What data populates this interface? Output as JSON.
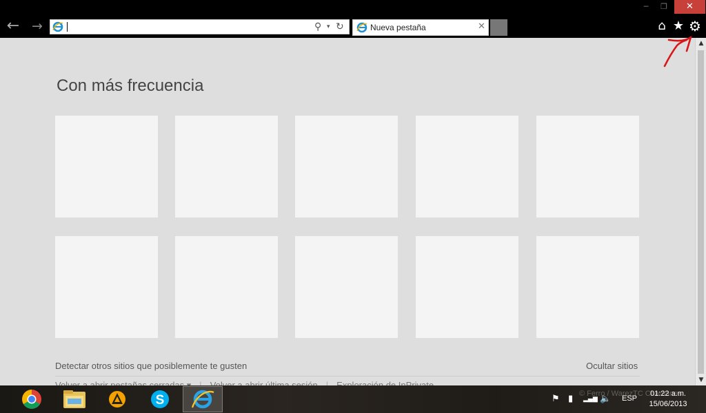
{
  "window": {
    "min_symbol": "─",
    "max_symbol": "❐",
    "close_symbol": "✕"
  },
  "nav": {
    "back_symbol": "←",
    "forward_symbol": "→",
    "address_value": "",
    "search_symbol": "⚲",
    "dropdown_symbol": "▾",
    "refresh_symbol": "↻"
  },
  "tab": {
    "label": "Nueva pestaña",
    "close_symbol": "✕"
  },
  "toolbar": {
    "home_icon": "home-icon",
    "home_symbol": "⌂",
    "favorites_icon": "star-icon",
    "favorites_symbol": "★",
    "tools_icon": "gear-icon",
    "tools_symbol": "⚙"
  },
  "content": {
    "heading": "Con más frecuencia",
    "detect_link": "Detectar otros sitios que posiblemente te gusten",
    "hide_link": "Ocultar sitios",
    "bottom_links": [
      "Volver a abrir pestañas cerradas ▾",
      "Volver a abrir última sesión",
      "Exploración de InPrivate"
    ],
    "tiles_count": 10
  },
  "scrollbar": {
    "up_symbol": "▲",
    "down_symbol": "▼"
  },
  "taskbar": {
    "apps": [
      {
        "name": "chrome",
        "active": false
      },
      {
        "name": "explorer",
        "active": false
      },
      {
        "name": "aimp",
        "active": false
      },
      {
        "name": "skype",
        "active": false
      },
      {
        "name": "internet-explorer",
        "active": true
      }
    ],
    "tray": {
      "flag_symbol": "⚑",
      "power_symbol": "▮",
      "signal_symbol": "▂▄▆",
      "volume_symbol": "🔈",
      "language": "ESP"
    },
    "time": "01:22 a.m.",
    "date": "15/06/2013",
    "watermark": "© Ferro / WarezTC Chamanes"
  },
  "colors": {
    "close_button": "#c7403a",
    "content_bg": "#dedede",
    "tile_bg": "#f4f4f4",
    "ie_blue": "#1e90d6",
    "annotation_red": "#d81818"
  }
}
